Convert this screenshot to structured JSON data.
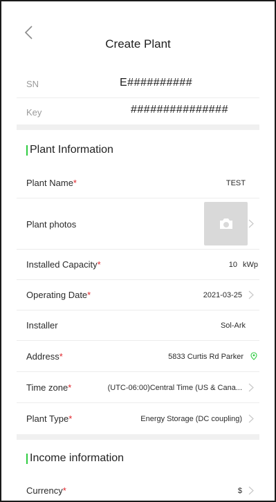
{
  "header": {
    "title": "Create Plant"
  },
  "device": {
    "sn_label": "SN",
    "sn_value": "E##########",
    "key_label": "Key",
    "key_value": "###############"
  },
  "plant_info": {
    "section_title": "Plant Information",
    "rows": {
      "name": {
        "label": "Plant Name",
        "value": "TEST"
      },
      "photos": {
        "label": "Plant photos"
      },
      "capacity": {
        "label": "Installed Capacity",
        "value": "10",
        "unit": "kWp"
      },
      "date": {
        "label": "Operating Date",
        "value": "2021-03-25"
      },
      "installer": {
        "label": "Installer",
        "value": "Sol-Ark"
      },
      "address": {
        "label": "Address",
        "value": "5833 Curtis Rd Parker"
      },
      "timezone": {
        "label": "Time zone",
        "value": "(UTC-06:00)Central Time (US & Cana..."
      },
      "type": {
        "label": "Plant Type",
        "value": "Energy Storage (DC coupling)"
      }
    }
  },
  "income_info": {
    "section_title": "Income information",
    "rows": {
      "currency": {
        "label": "Currency",
        "value": "$"
      }
    }
  },
  "required_mark": "*",
  "colors": {
    "accent_green": "#2ecc40",
    "required_red": "#e0242a",
    "photo_bg": "#d9d9d9"
  },
  "icons": {
    "back": "chevron-left-icon",
    "camera": "camera-icon",
    "location": "location-pin-icon",
    "next": "chevron-right-icon"
  }
}
